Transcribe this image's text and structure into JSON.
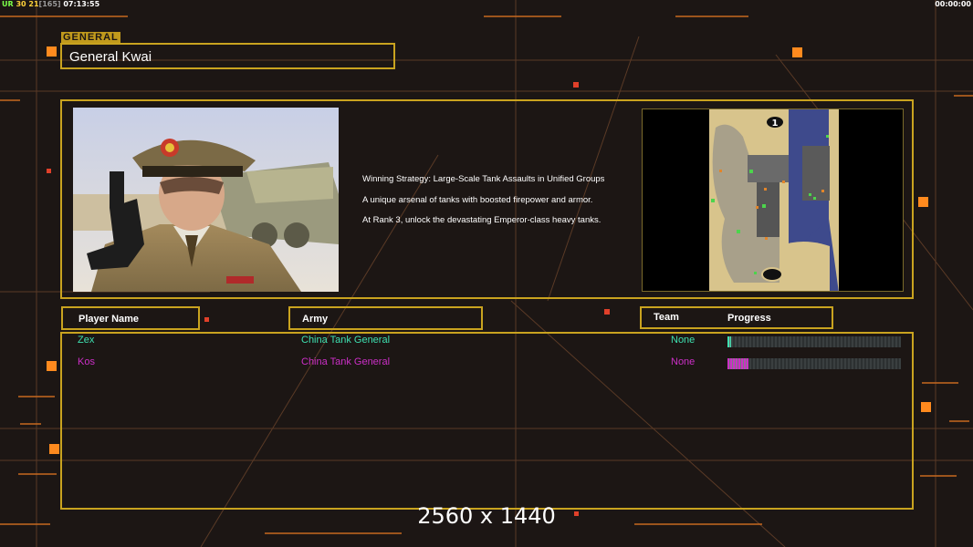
{
  "hud": {
    "ur": "UR",
    "a": "30",
    "b": "21",
    "c": "[165]",
    "clock": "07:13:55",
    "timer": "00:00:00"
  },
  "section_label": "GENERAL",
  "general_name": "General Kwai",
  "description": [
    "Winning Strategy: Large-Scale Tank Assaults in Unified Groups",
    "A unique arsenal of tanks with boosted firepower and armor.",
    "At Rank 3, unlock the devastating Emperor-class heavy tanks."
  ],
  "minimap": {
    "start_marker": "1"
  },
  "columns": {
    "player": "Player Name",
    "army": "Army",
    "team": "Team",
    "progress": "Progress"
  },
  "players": [
    {
      "name": "Zex",
      "army": "China Tank General",
      "team": "None",
      "progress": 0.02,
      "color": "#3ee0b0"
    },
    {
      "name": "Kos",
      "army": "China Tank General",
      "team": "None",
      "progress": 0.12,
      "color": "#cc2fc7"
    }
  ],
  "resolution_label": "2560 x 1440",
  "colors": {
    "accent": "#c9a31f",
    "background": "#1c1614"
  }
}
